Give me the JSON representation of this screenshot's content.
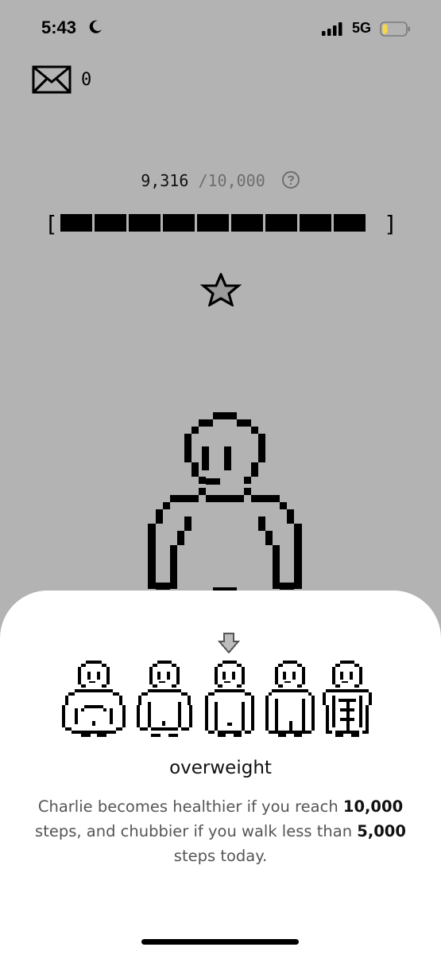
{
  "status_bar": {
    "time": "5:43",
    "network": "5G",
    "icons": [
      "moon-icon",
      "signal-icon",
      "battery-icon"
    ]
  },
  "mail": {
    "icon": "envelope-icon",
    "count": "0"
  },
  "steps": {
    "current": "9,316",
    "goal": "/10,000",
    "help_icon": "question-circle-icon",
    "progress_segments_filled": 9,
    "progress_segments_total": 10,
    "progress_left_bracket": "[",
    "progress_right_bracket": "]"
  },
  "rank_icon": "star-icon",
  "sheet": {
    "pointer_icon": "down-arrow-icon",
    "stages": [
      "stage-1-obese",
      "stage-2-chubby",
      "stage-3-overweight",
      "stage-4-fit",
      "stage-5-muscular"
    ],
    "selected_stage_index": 2,
    "stage_label": "overweight",
    "description": {
      "part1": "Charlie becomes healthier if you reach ",
      "bold1": "10,000",
      "part2": " steps, and chubbier if you walk less than ",
      "bold2": "5,000",
      "part3": " steps today."
    }
  },
  "colors": {
    "background": "#b3b3b3",
    "sheet": "#ffffff",
    "pixel_ink": "#000000",
    "muted_text": "#6e6e6e"
  }
}
